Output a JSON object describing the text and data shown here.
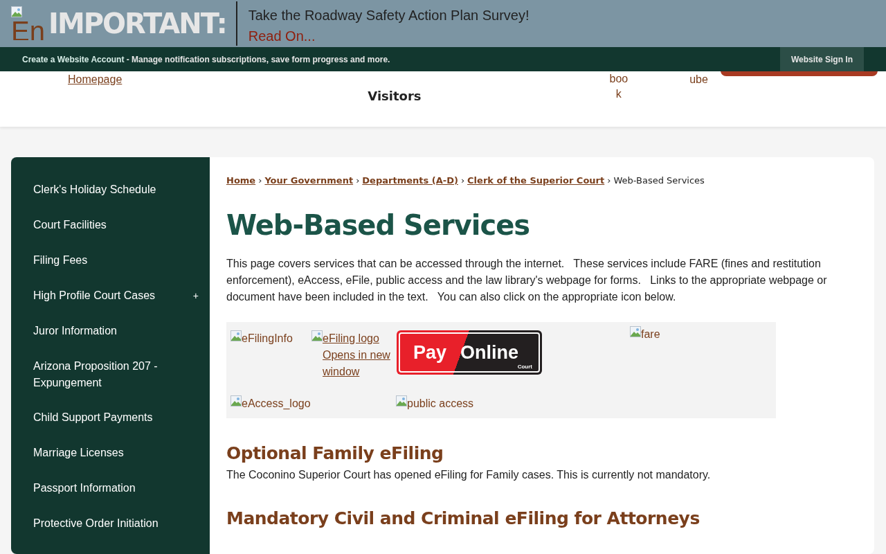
{
  "alert": {
    "logo_text": "En",
    "label": "IMPORTANT:",
    "message": "Take the Roadway Safety Action Plan Survey!",
    "link": "Read On..."
  },
  "account_bar": {
    "link": "Create a Website Account",
    "text": " - Manage notification subscriptions, save form progress and more.",
    "sign_in": "Website Sign In"
  },
  "header": {
    "home_link": "Homepage",
    "nav_item": "Visitors",
    "social": [
      {
        "lines": [
          "boo",
          "k"
        ]
      },
      {
        "lines": [
          "ube"
        ]
      }
    ]
  },
  "sidebar": {
    "items": [
      {
        "label": "Clerk's Holiday Schedule"
      },
      {
        "label": "Court Facilities"
      },
      {
        "label": "Filing Fees"
      },
      {
        "label": "High Profile Court Cases",
        "toggle": "+"
      },
      {
        "label": "Juror Information"
      },
      {
        "label": "Arizona Proposition 207 - Expungement"
      },
      {
        "label": "Child Support Payments"
      },
      {
        "label": "Marriage Licenses"
      },
      {
        "label": "Passport Information"
      },
      {
        "label": "Protective Order Initiation"
      }
    ]
  },
  "breadcrumb": {
    "links": [
      "Home",
      "Your Government",
      "Departments (A-D)",
      "Clerk of the Superior Court"
    ],
    "separator": "›",
    "current": "Web-Based Services"
  },
  "title": "Web-Based Services",
  "intro": "This page covers services that can be accessed through the internet.   These services include FARE (fines and restitution enforcement), eAccess, eFile, public access and the law library's webpage for forms.   Links to the appropriate webpage or document have been included in the text.   You can also click on the appropriate icon below.",
  "icons_table": {
    "row_1": [
      {
        "kind": "broken",
        "alt": "eFilingInfo",
        "link": false
      },
      {
        "kind": "broken",
        "alt": "eFiling logo Opens in new window",
        "link": true
      },
      {
        "kind": "pay",
        "left": "Pay",
        "right": "Online",
        "brand": "Court"
      },
      {
        "kind": "broken",
        "alt": "fare",
        "link": false
      }
    ],
    "row_2": [
      {
        "kind": "broken",
        "alt": "eAccess_logo",
        "link": false
      },
      {
        "kind": "broken",
        "alt": "public access",
        "link": false
      }
    ]
  },
  "sections": [
    {
      "heading": "Optional Family eFiling",
      "text": "The Coconino Superior Court has opened eFiling for Family cases. This is currently not mandatory."
    },
    {
      "heading": "Mandatory Civil and Criminal eFiling for Attorneys"
    }
  ]
}
